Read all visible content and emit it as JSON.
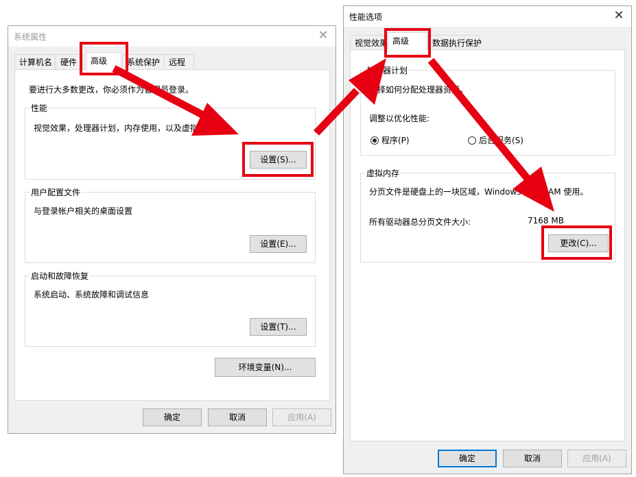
{
  "sys": {
    "title": "系统属性",
    "tabs": [
      "计算机名",
      "硬件",
      "高级",
      "系统保护",
      "远程"
    ],
    "admin_note": "要进行大多数更改，你必须作为管理员登录。",
    "performance": {
      "title": "性能",
      "desc": "视觉效果，处理器计划，内存使用，以及虚拟内存",
      "button": "设置(S)..."
    },
    "profile": {
      "title": "用户配置文件",
      "desc": "与登录帐户相关的桌面设置",
      "button": "设置(E)..."
    },
    "startup": {
      "title": "启动和故障恢复",
      "desc": "系统启动、系统故障和调试信息",
      "button": "设置(T)..."
    },
    "env_button": "环境变量(N)...",
    "ok": "确定",
    "cancel": "取消",
    "apply": "应用(A)"
  },
  "perf": {
    "title": "性能选项",
    "tabs": [
      "视觉效果",
      "高级",
      "数据执行保护"
    ],
    "scheduling": {
      "title": "处理器计划",
      "desc": "选择如何分配处理器资源。",
      "adjust": "调整以优化性能:",
      "option_programs": "程序(P)",
      "option_services": "后台服务(S)"
    },
    "virtual_memory": {
      "title": "虚拟内存",
      "desc": "分页文件是硬盘上的一块区域，Windows 当作 RAM 使用。",
      "total_label": "所有驱动器总分页文件大小:",
      "total_value": "7168 MB",
      "button": "更改(C)..."
    },
    "ok": "确定",
    "cancel": "取消",
    "apply": "应用(A)"
  },
  "colors": {
    "highlight": "#e60012",
    "primary_border": "#0078d7"
  }
}
